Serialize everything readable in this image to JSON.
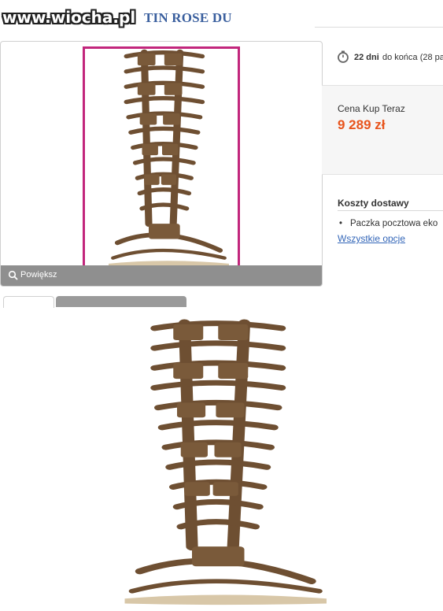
{
  "header": {
    "title_visible": "TIN ROSE DU",
    "watermark": "www.wiocha.pl"
  },
  "gallery": {
    "zoom_label": "Powiększ",
    "zoom_icon": "magnifier-icon"
  },
  "offer": {
    "time_left": "22 dni",
    "time_left_rest": "do końca (28 pa",
    "timer_icon": "stopwatch-icon",
    "price_label": "Cena Kup Teraz",
    "price_value": "9 289 zł",
    "price_color": "#e8541c"
  },
  "shipping": {
    "title": "Koszty dostawy",
    "items": [
      {
        "label": "Paczka pocztowa eko"
      }
    ],
    "all_options_link": "Wszystkie opcje"
  },
  "colors": {
    "title": "#3a5f9e",
    "frame": "#c2267c",
    "leather": "#7a5a3a",
    "link": "#3366b8"
  }
}
